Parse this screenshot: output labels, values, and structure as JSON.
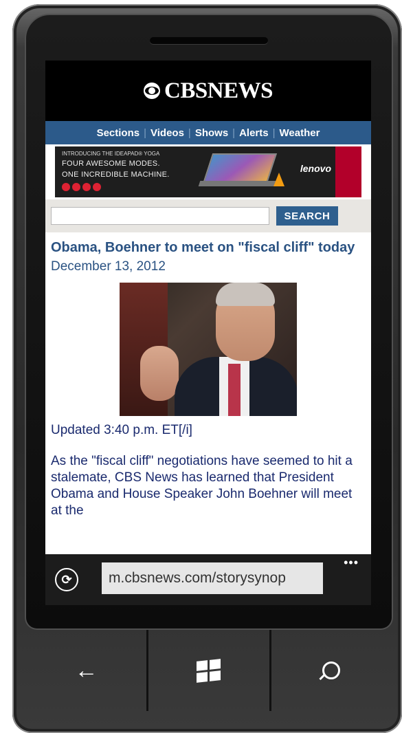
{
  "header": {
    "brand": "CBSNEWS"
  },
  "nav": {
    "items": [
      "Sections",
      "Videos",
      "Shows",
      "Alerts",
      "Weather"
    ]
  },
  "ad": {
    "kicker": "INTRODUCING THE IDEAPAD® YOGA",
    "line1": "FOUR AWESOME MODES.",
    "line2": "ONE INCREDIBLE MACHINE.",
    "brand": "lenovo"
  },
  "search": {
    "placeholder": "",
    "button_label": "SEARCH"
  },
  "article": {
    "headline": "Obama, Boehner to meet on \"fiscal cliff\" today",
    "date": "December 13, 2012",
    "updated": "Updated 3:40 p.m. ET[/i]",
    "body": "As the \"fiscal cliff\" negotiations have seemed to hit a stalemate, CBS News has learned that President Obama and House Speaker John Boehner will meet at the"
  },
  "browser": {
    "url": "m.cbsnews.com/storysynop",
    "more": "•••"
  },
  "hardware": {
    "back": "←"
  }
}
